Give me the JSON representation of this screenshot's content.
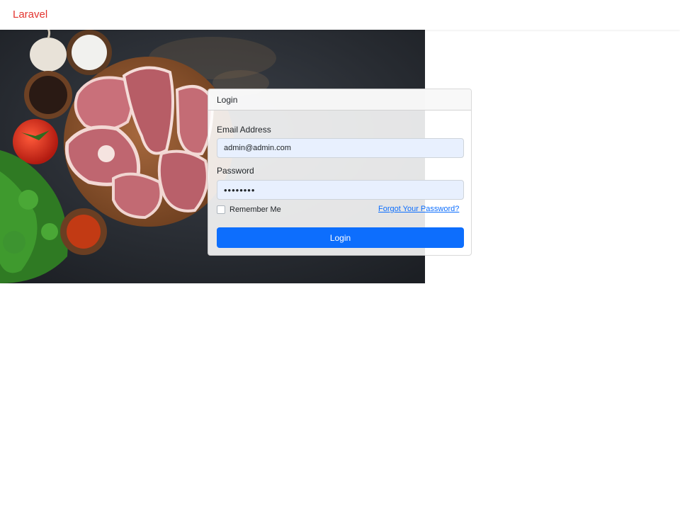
{
  "navbar": {
    "brand": "Laravel"
  },
  "hero": {
    "image": "raw-meat-cuts-on-wooden-board"
  },
  "login_card": {
    "title": "Login",
    "email_label": "Email Address",
    "email_value": "admin@admin.com",
    "password_label": "Password",
    "password_value": "••••••••",
    "remember_label": "Remember Me",
    "remember_checked": false,
    "forgot_link": "Forgot Your Password?",
    "submit_label": "Login"
  },
  "colors": {
    "brand": "#e3342f",
    "primary": "#0d6efd",
    "input_bg": "#e8f0fe"
  }
}
